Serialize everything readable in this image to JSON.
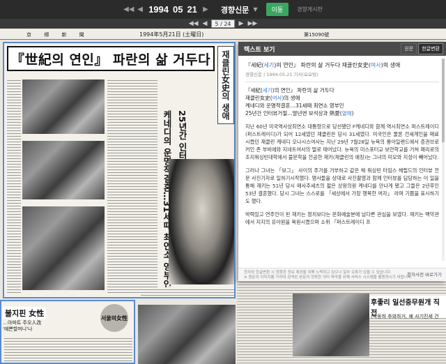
{
  "topbar": {
    "year": "1994",
    "month": "05",
    "day": "21",
    "newspaper": "경향신문",
    "go_label": "이동",
    "text_link": "경향게시판"
  },
  "pager": {
    "page_display": "5 / 24"
  },
  "newspaper_page": {
    "masthead_left": "京 鄕 新 聞",
    "masthead_date": "1994年5月21日 (土曜日)",
    "masthead_right": "第15090號",
    "headline": "『世紀의 연인』 파란의 삶 거두다",
    "vertical_subtitle": "재클린女史의 생애",
    "vertical_headline_1": "케네디의 운명적결혼…31세때 최연소 영부인",
    "vertical_headline_2": "25년간 인터뷰거절…말년엔 보석상과 熱愛",
    "bottom_left_headline": "불지핀 女性",
    "bottom_left_line1": "…아파트 주오人改",
    "bottom_left_line2": "'예쁜할머니'나",
    "bottom_left_badge": "서울의女性",
    "bottom_right_headline": "후좋리 일선중무원개 직전",
    "bottom_right_sub": "(박동하 추와하거, 예 사기진세 건"
  },
  "text_panel": {
    "title": "텍스트 보기",
    "btn_original": "원문",
    "btn_hangul": "한글변환",
    "article_title_pre": "『세紀(",
    "article_title_hl1": "세기",
    "article_title_mid": ")의 연인』 파란의 삶 거두다 재클린女史(",
    "article_title_hl2": "여사",
    "article_title_post": ")의 생애",
    "meta": "경향신문 | 1994.05.21 기사(요요팅)",
    "line1_pre": "『세紀(",
    "line1_hl": "세기",
    "line1_post": ")의 연인』 파란의 삶 거두다",
    "line2_pre": "재클린女史(",
    "line2_hl": "여사",
    "line2_post": ")의 생애",
    "line3": "케네디와 운명적결혼…31세때 최연소 영부인",
    "line4_pre": "25년간 인터뷰거절…말년엔 보석상과 熱愛(",
    "line4_hl": "열애",
    "line4_post": ")",
    "para1": "지난 60년 미국역사상최연소 대통령으로 당선됐던 F케네디와 함께 역시최연소 퍼스트레이디(퍼스트레이디)가 되어 12세였던 재클린은 당시 31세였다. 미국인은 물론 전세계인을 매료시켰던 재클린 케네디 오나시스여사는 지난 29년 7월28일 뉴욕의 롱아일랜드에서 증권브로커인 존 부비에와 지네트여사의 딸로 태어났다. 뉴욕의 미스포터교 보안학교를 거쳐 패리로의 조지워싱턴대학에서 불문학을 전공한 재키(재클린의 애칭)는 그녀의 미모와 지성이 빼어났다.",
    "para2": "그러나 그녀는 「보그」 사이의 주가를 거부하고 같은 해 워싱턴 타임스 헤럴드의 인터뷰 전문 사진기자로 일하기시작했다. 명사들을 상대로 사진촬영과 함께 인터뷰를 담당하는 이 일을 통해 재키는 51년 당시 매사추세츠의 젊은 상원의원 케네디를 만나게 됐고 그들은 2년후인 53년 결혼했다. 당시 그녀는 스스로를 「세상에서 가장 행복한 여자」 라며 기쁨을 표시하기도 했다.",
    "para3": "박력있고 연주인이 된 재키는 정치보다는 문화예술분에 남다른 관심을 보였다. 재키는 백악관 에서 지지의 유아원을 복원시켰으며 소위 「퍼스트레이디 프",
    "footer_note": "한자와 한글변환 시 정확한 정보 제공을 위해 노력하고 있으나 일부 오류가 있을 수 있습니다.",
    "footer_note2": "※ 원문의 이미지를 가하여 검색된 본문의 정확한 의미 파악을 위해 서비스 시스템을 활용하시기 바랍니다.",
    "footer_right": "한자사전 바로가기"
  }
}
